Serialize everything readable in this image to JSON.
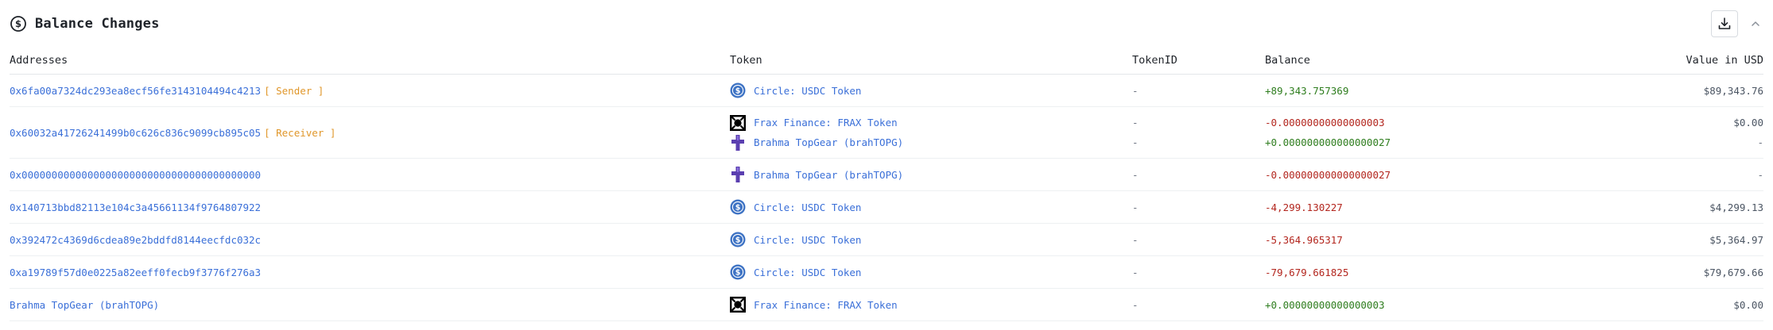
{
  "header": {
    "title": "Balance Changes",
    "title_icon": "dollar-circle-icon",
    "download_icon": "download-icon",
    "collapse_icon": "chevron-up-icon"
  },
  "columns": {
    "addresses": "Addresses",
    "token": "Token",
    "token_id": "TokenID",
    "balance": "Balance",
    "value_usd": "Value in USD"
  },
  "colors": {
    "link": "#3a6fd8",
    "role_tag": "#e0972b",
    "positive": "#2e7d1e",
    "negative": "#b3261e",
    "usdc_icon": "#3e73c4",
    "brahma_icon": "#5b3fb0"
  },
  "rows": [
    {
      "address": "0x6fa00a7324dc293ea8ecf56fe3143104494c4213",
      "role": "[ Sender ]",
      "entries": [
        {
          "icon": "usdc-icon",
          "token": "Circle: USDC Token",
          "token_id": "-",
          "balance": "+89,343.757369",
          "value_usd": "$89,343.76"
        }
      ]
    },
    {
      "address": "0x60032a41726241499b0c626c836c9099cb895c05",
      "role": "[ Receiver ]",
      "entries": [
        {
          "icon": "frax-icon",
          "token": "Frax Finance: FRAX Token",
          "token_id": "-",
          "balance": "-0.00000000000000003",
          "value_usd": "$0.00"
        },
        {
          "icon": "brahma-icon",
          "token": "Brahma TopGear (brahTOPG)",
          "token_id": "-",
          "balance": "+0.000000000000000027",
          "value_usd": "-"
        }
      ]
    },
    {
      "address": "0x0000000000000000000000000000000000000000",
      "role": "",
      "entries": [
        {
          "icon": "brahma-icon",
          "token": "Brahma TopGear (brahTOPG)",
          "token_id": "-",
          "balance": "-0.000000000000000027",
          "value_usd": "-"
        }
      ]
    },
    {
      "address": "0x140713bbd82113e104c3a45661134f9764807922",
      "role": "",
      "entries": [
        {
          "icon": "usdc-icon",
          "token": "Circle: USDC Token",
          "token_id": "-",
          "balance": "-4,299.130227",
          "value_usd": "$4,299.13"
        }
      ]
    },
    {
      "address": "0x392472c4369d6cdea89e2bddfd8144eecfdc032c",
      "role": "",
      "entries": [
        {
          "icon": "usdc-icon",
          "token": "Circle: USDC Token",
          "token_id": "-",
          "balance": "-5,364.965317",
          "value_usd": "$5,364.97"
        }
      ]
    },
    {
      "address": "0xa19789f57d0e0225a82eeff0fecb9f3776f276a3",
      "role": "",
      "entries": [
        {
          "icon": "usdc-icon",
          "token": "Circle: USDC Token",
          "token_id": "-",
          "balance": "-79,679.661825",
          "value_usd": "$79,679.66"
        }
      ]
    },
    {
      "address": "Brahma TopGear (brahTOPG)",
      "role": "",
      "entries": [
        {
          "icon": "frax-icon",
          "token": "Frax Finance: FRAX Token",
          "token_id": "-",
          "balance": "+0.00000000000000003",
          "value_usd": "$0.00"
        }
      ]
    }
  ]
}
